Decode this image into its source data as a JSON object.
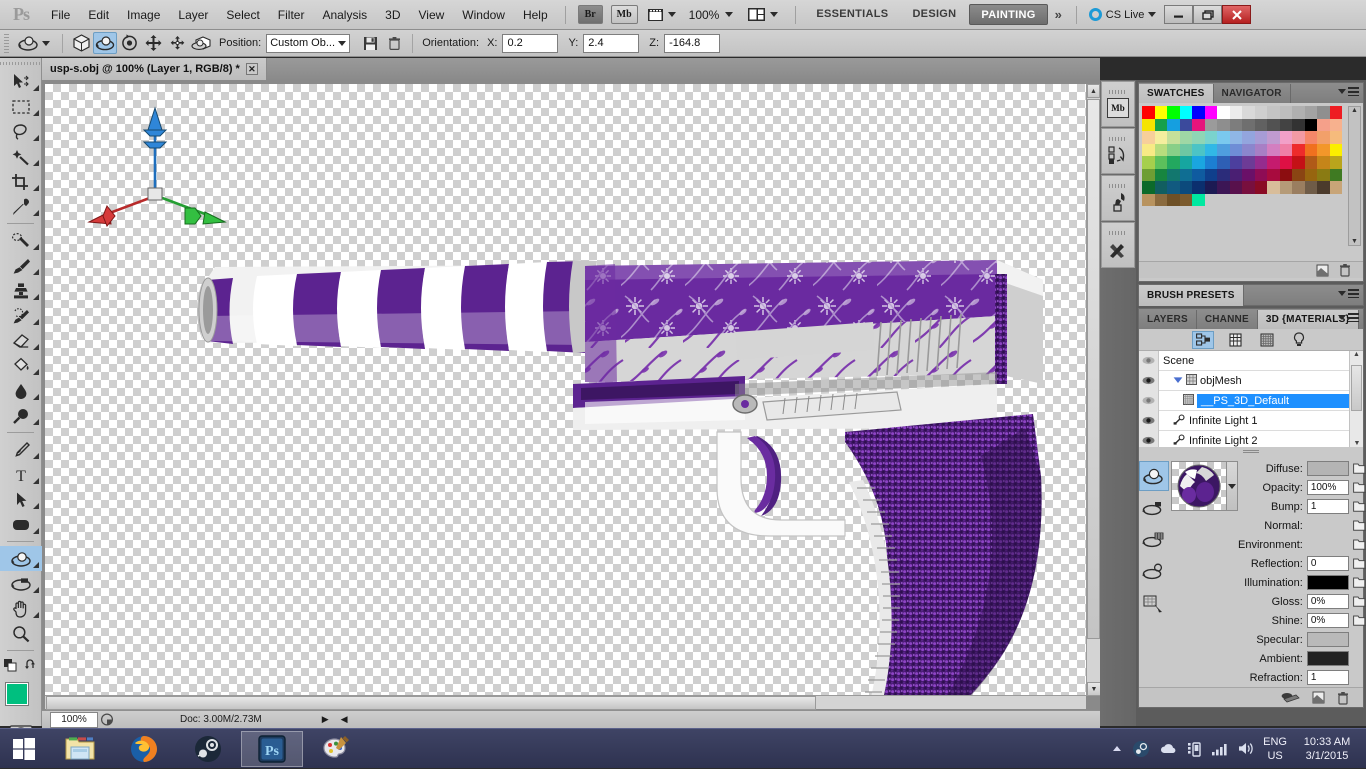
{
  "app": {
    "logo": "Ps",
    "menus": [
      "File",
      "Edit",
      "Image",
      "Layer",
      "Select",
      "Filter",
      "Analysis",
      "3D",
      "View",
      "Window",
      "Help"
    ],
    "bridge_label": "Br",
    "minibridge_label": "Mb",
    "zoom_level": "100%",
    "workspaces": [
      {
        "label": "ESSENTIALS",
        "active": false
      },
      {
        "label": "DESIGN",
        "active": false
      },
      {
        "label": "PAINTING",
        "active": true
      }
    ],
    "more_workspaces": "»",
    "cs_live": "CS Live",
    "window_buttons": {
      "minimize": "–",
      "restore": "❐",
      "close": "✕"
    }
  },
  "options_bar": {
    "position_label": "Position:",
    "position_value": "Custom Ob...",
    "orientation_label": "Orientation:",
    "x_label": "X:",
    "x_value": "0.2",
    "y_label": "Y:",
    "y_value": "2.4",
    "z_label": "Z:",
    "z_value": "-164.8",
    "mode_icons": [
      "cube-icon",
      "orbit-3d-icon",
      "roll-3d-icon",
      "pan-3d-icon",
      "slide-3d-icon",
      "scale-3d-icon"
    ],
    "selected_mode_index": 1,
    "save_icon": "save-disk-icon",
    "delete_icon": "trash-icon"
  },
  "toolbar": {
    "tools": [
      {
        "name": "move-tool",
        "glyph": "move"
      },
      {
        "name": "marquee-tool",
        "glyph": "marquee"
      },
      {
        "name": "lasso-tool",
        "glyph": "lasso"
      },
      {
        "name": "quick-selection-tool",
        "glyph": "wand"
      },
      {
        "name": "crop-tool",
        "glyph": "crop"
      },
      {
        "name": "eyedropper-tool",
        "glyph": "eyedropper"
      },
      {
        "name": "spot-healing-tool",
        "glyph": "healing"
      },
      {
        "name": "brush-tool",
        "glyph": "brush"
      },
      {
        "name": "clone-stamp-tool",
        "glyph": "stamp"
      },
      {
        "name": "history-brush-tool",
        "glyph": "history-brush"
      },
      {
        "name": "eraser-tool",
        "glyph": "eraser"
      },
      {
        "name": "gradient-tool",
        "glyph": "bucket"
      },
      {
        "name": "blur-tool",
        "glyph": "drop"
      },
      {
        "name": "dodge-tool",
        "glyph": "dodge"
      },
      {
        "name": "pen-tool",
        "glyph": "pen"
      },
      {
        "name": "type-tool",
        "glyph": "type"
      },
      {
        "name": "path-selection-tool",
        "glyph": "arrow"
      },
      {
        "name": "rectangle-tool",
        "glyph": "rounded-rect"
      },
      {
        "name": "3d-object-rotate-tool",
        "glyph": "obj3d",
        "selected": true
      },
      {
        "name": "3d-camera-rotate-tool",
        "glyph": "cam3d"
      },
      {
        "name": "hand-tool",
        "glyph": "hand"
      },
      {
        "name": "zoom-tool",
        "glyph": "magnifier"
      }
    ],
    "foreground_color": "#00bf7f",
    "background_color": "#e81f1f",
    "quick-mask": "quick-mask-icon"
  },
  "document": {
    "tab_title": "usp-s.obj @ 100% (Layer 1, RGB/8) *",
    "close_label": "✕"
  },
  "status_bar": {
    "zoom": "100%",
    "doc_info": "Doc: 3.00M/2.73M",
    "arrow_right": "▶",
    "arrow_left": "◀"
  },
  "mini_dock": {
    "buttons": [
      "mini-bridge-icon",
      "history-icon",
      "brush-icon",
      "tools-icon"
    ],
    "mini_bridge_label": "Mb"
  },
  "swatches_panel": {
    "tabs": [
      {
        "label": "SWATCHES",
        "active": true
      },
      {
        "label": "NAVIGATOR",
        "active": false
      }
    ],
    "colors": [
      "#ff0000",
      "#ffff00",
      "#00ff00",
      "#00ffff",
      "#0000ff",
      "#ff00ff",
      "#ffffff",
      "#ececec",
      "#d9d9d9",
      "#cfcfcf",
      "#c4c4c4",
      "#bdbdbd",
      "#b0b0b0",
      "#a3a3a3",
      "#8f8f8f",
      "#ee1c22",
      "#f5e400",
      "#16a04a",
      "#159fe0",
      "#3b4a9c",
      "#e6137c",
      "#9b9b9b",
      "#8e8e8e",
      "#7d7d7d",
      "#6f6f6f",
      "#616161",
      "#525252",
      "#434343",
      "#333333",
      "#000000",
      "#f5a08a",
      "#f7b18e",
      "#f7cf9a",
      "#f5ee9e",
      "#c6e09a",
      "#9fd7a5",
      "#8fd5b5",
      "#7ad3cd",
      "#7ac9ee",
      "#8fb6e6",
      "#93a5de",
      "#a79cd6",
      "#c09bd0",
      "#f2a0c8",
      "#f39aa4",
      "#f58769",
      "#f2a06a",
      "#f6bb7c",
      "#f8ea85",
      "#b8dd7d",
      "#88cf88",
      "#6ec7a3",
      "#4cc4c6",
      "#31b8e6",
      "#4f9ede",
      "#6f8dd6",
      "#8b86cd",
      "#a87fc5",
      "#d37fc0",
      "#ef7fa6",
      "#ee2b2b",
      "#f0701f",
      "#f3972a",
      "#fbee00",
      "#a6cf4d",
      "#5cc05c",
      "#23a85f",
      "#16a6a0",
      "#1aa6e0",
      "#1c7fd2",
      "#2e5fb5",
      "#4c3f9e",
      "#6d3b96",
      "#952c8e",
      "#c51b6e",
      "#de1044",
      "#c41116",
      "#b05a18",
      "#c58519",
      "#b9a51c",
      "#6e9e34",
      "#17853f",
      "#12776e",
      "#0f6e93",
      "#0f5ba0",
      "#0f3f8c",
      "#2b2c7a",
      "#4a1f73",
      "#6a1068",
      "#8e0c55",
      "#a80b3e",
      "#8c0d10",
      "#8a4513",
      "#97650f",
      "#8a7b13",
      "#3f7a22",
      "#0b6a2a",
      "#115e60",
      "#115a80",
      "#0c4a7c",
      "#0b2f6e",
      "#1c1a53",
      "#3c1655",
      "#58114c",
      "#780f3e",
      "#8a0b24",
      "#d8bd9a",
      "#b59b78",
      "#9a7e60",
      "#6f5c48",
      "#4b3b2c",
      "#c8a578",
      "#b8935f",
      "#8a6a3e",
      "#6e5026",
      "#7b5a2d",
      "#00e8a0",
      "#c9c9c9",
      "#c9c9c9",
      "#c9c9c9",
      "#c9c9c9",
      "#c9c9c9",
      "#c9c9c9",
      "#c9c9c9",
      "#c9c9c9",
      "#c9c9c9",
      "#c9c9c9",
      "#c9c9c9"
    ],
    "footer_icons": [
      "new-swatch-icon",
      "delete-swatch-icon"
    ]
  },
  "brush_presets_panel": {
    "tab_label": "BRUSH PRESETS"
  },
  "three_d_panel": {
    "tabs": [
      {
        "label": "LAYERS",
        "active": false
      },
      {
        "label": "CHANNE",
        "active": false
      },
      {
        "label": "3D {MATERIALS}",
        "active": true
      }
    ],
    "filter_icons": [
      "scene-filter-icon",
      "mesh-filter-icon",
      "materials-filter-icon",
      "lights-filter-icon"
    ],
    "selected_filter_index": 0,
    "scene_items": [
      {
        "label": "Scene",
        "indent": 0,
        "icon": "none",
        "selected": false,
        "eye": "dim"
      },
      {
        "label": "objMesh",
        "indent": 1,
        "icon": "mesh-icon",
        "selected": false,
        "eye": "on",
        "expander": true
      },
      {
        "label": "__PS_3D_Default",
        "indent": 2,
        "icon": "material-icon",
        "selected": true,
        "eye": "dim"
      },
      {
        "label": "Infinite Light 1",
        "indent": 1,
        "icon": "light-icon",
        "selected": false,
        "eye": "on"
      },
      {
        "label": "Infinite Light 2",
        "indent": 1,
        "icon": "light-icon",
        "selected": false,
        "eye": "on"
      }
    ],
    "material_tool_icons": [
      "material-drop-icon",
      "material-pick-icon",
      "material-mesh-icon",
      "material-select-icon",
      "material-fill-icon"
    ],
    "selected_material_tool_index": 0,
    "properties": [
      {
        "label": "Diffuse:",
        "type": "color",
        "value": "#b4b4b4",
        "folder": "texture-menu-icon"
      },
      {
        "label": "Opacity:",
        "type": "text",
        "value": "100%",
        "folder": "folder-icon"
      },
      {
        "label": "Bump:",
        "type": "text",
        "value": "1",
        "folder": "folder-icon"
      },
      {
        "label": "Normal:",
        "type": "none",
        "value": "",
        "folder": "folder-icon"
      },
      {
        "label": "Environment:",
        "type": "none",
        "value": "",
        "folder": "folder-icon"
      },
      {
        "label": "Reflection:",
        "type": "text",
        "value": "0",
        "folder": "folder-icon"
      },
      {
        "label": "Illumination:",
        "type": "color",
        "value": "#000000",
        "folder": "folder-icon"
      },
      {
        "label": "Gloss:",
        "type": "text",
        "value": "0%",
        "folder": "folder-icon"
      },
      {
        "label": "Shine:",
        "type": "text",
        "value": "0%",
        "folder": "folder-icon"
      },
      {
        "label": "Specular:",
        "type": "color",
        "value": "#b9b9b9",
        "folder": ""
      },
      {
        "label": "Ambient:",
        "type": "color",
        "value": "#222222",
        "folder": ""
      },
      {
        "label": "Refraction:",
        "type": "text",
        "value": "1",
        "folder": ""
      }
    ],
    "footer_icons": [
      "ground-plane-icon",
      "new-material-icon",
      "delete-material-icon"
    ]
  },
  "canvas": {
    "axis_widget": {
      "x_color": "#cc2222",
      "y_color": "#1f78c8",
      "z_color": "#22aa33"
    },
    "model_name": "usp-s pistol with purple floral skin",
    "colors": {
      "purple_dark": "#4b1f78",
      "purple": "#6a2ca0",
      "purple_bright": "#7b2fae",
      "white": "#f2f2f2",
      "grey": "#c9c9c9"
    }
  },
  "taskbar": {
    "start_icon": "windows-start-icon",
    "apps": [
      {
        "name": "file-explorer",
        "active": false
      },
      {
        "name": "firefox",
        "active": false
      },
      {
        "name": "steam",
        "active": false
      },
      {
        "name": "photoshop",
        "active": true
      },
      {
        "name": "paint",
        "active": false
      }
    ],
    "tray_icons": [
      "show-hidden-icon",
      "steam-tray-icon",
      "onedrive-icon",
      "device-icon",
      "signal-icon",
      "volume-icon"
    ],
    "language_line1": "ENG",
    "language_line2": "US",
    "time": "10:33 AM",
    "date": "3/1/2015"
  }
}
